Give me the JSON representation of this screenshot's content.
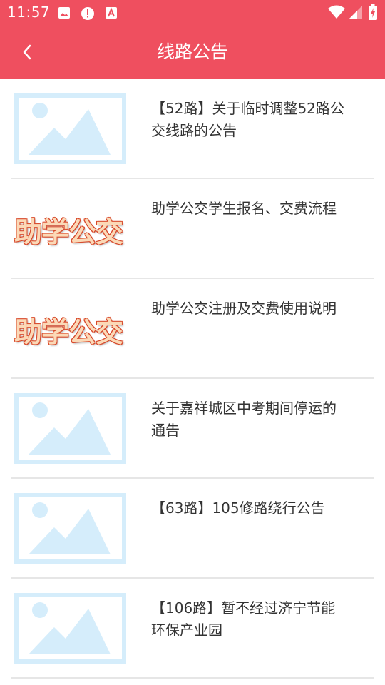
{
  "status_bar": {
    "time": "11:57",
    "icons": [
      "image-icon",
      "alert-icon",
      "keyboard-icon",
      "wifi-icon",
      "signal-icon",
      "battery-icon"
    ]
  },
  "header": {
    "title": "线路公告",
    "back_icon": "chevron-left-icon",
    "background_color": "#ef4f5f"
  },
  "notices": [
    {
      "title": "【52路】关于临时调整52路公交线路的公告",
      "thumbnail": "placeholder-image"
    },
    {
      "title": "助学公交学生报名、交费流程",
      "thumbnail": "logo",
      "logo_text": "助学公交"
    },
    {
      "title": "助学公交注册及交费使用说明",
      "thumbnail": "logo",
      "logo_text": "助学公交"
    },
    {
      "title": "关于嘉祥城区中考期间停运的通告",
      "thumbnail": "placeholder-image"
    },
    {
      "title": "【63路】105修路绕行公告",
      "thumbnail": "placeholder-image"
    },
    {
      "title": "【106路】暂不经过济宁节能环保产业园",
      "thumbnail": "placeholder-image"
    }
  ]
}
